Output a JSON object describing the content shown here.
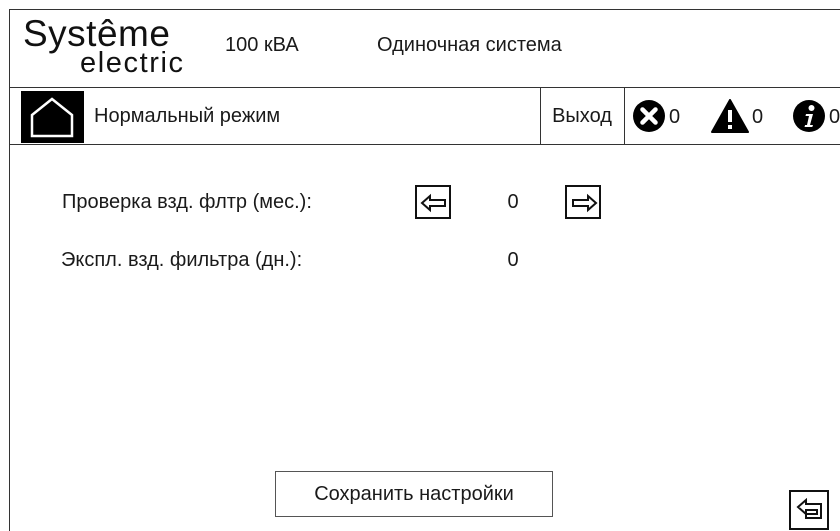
{
  "header": {
    "logo_line1": "Systême",
    "logo_line2": "electric",
    "rating": "100 кВА",
    "system": "Одиночная система"
  },
  "statusbar": {
    "home_icon": "home-icon",
    "mode": "Нормальный режим",
    "exit_label": "Выход",
    "alarms": {
      "icon": "error-icon",
      "count": "0"
    },
    "warnings": {
      "icon": "warning-icon",
      "count": "0"
    },
    "info": {
      "icon": "info-icon",
      "count": "0"
    }
  },
  "settings": {
    "filter_check": {
      "label": "Проверка взд. флтр (мес.):",
      "value": "0"
    },
    "filter_runtime": {
      "label": "Экспл. взд. фильтра (дн.):",
      "value": "0"
    }
  },
  "footer": {
    "save_label": "Сохранить настройки",
    "back_icon": "back-icon"
  }
}
